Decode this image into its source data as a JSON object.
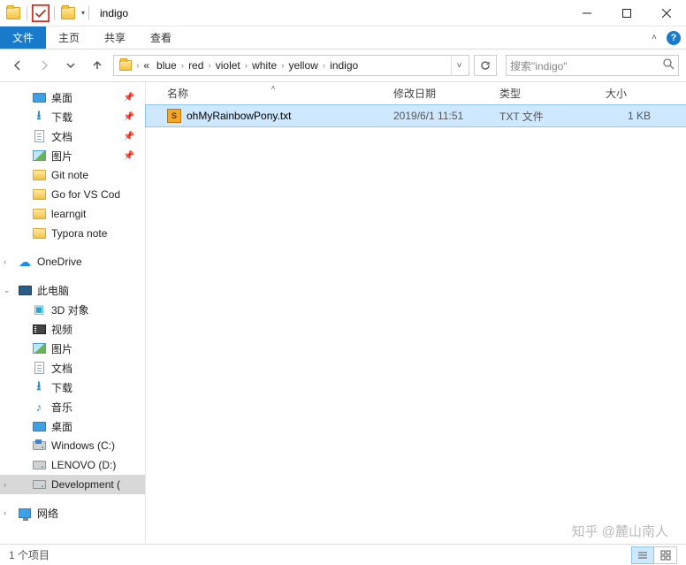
{
  "title": "indigo",
  "ribbon": {
    "file": "文件",
    "home": "主页",
    "share": "共享",
    "view": "查看"
  },
  "breadcrumbs": [
    "blue",
    "red",
    "violet",
    "white",
    "yellow",
    "indigo"
  ],
  "breadcrumb_overflow": "«",
  "search": {
    "placeholder": "搜索\"indigo\""
  },
  "columns": {
    "name": "名称",
    "date": "修改日期",
    "type": "类型",
    "size": "大小"
  },
  "files": [
    {
      "name": "ohMyRainbowPony.txt",
      "date": "2019/6/1 11:51",
      "type": "TXT 文件",
      "size": "1 KB"
    }
  ],
  "sidebar": {
    "quick": [
      {
        "label": "桌面",
        "icon": "desktop",
        "pinned": true
      },
      {
        "label": "下载",
        "icon": "download",
        "pinned": true
      },
      {
        "label": "文档",
        "icon": "doc",
        "pinned": true
      },
      {
        "label": "图片",
        "icon": "pic",
        "pinned": true
      },
      {
        "label": "Git note",
        "icon": "folder"
      },
      {
        "label": "Go for VS Cod",
        "icon": "folder"
      },
      {
        "label": "learngit",
        "icon": "folder"
      },
      {
        "label": "Typora note",
        "icon": "folder"
      }
    ],
    "onedrive": "OneDrive",
    "thispc": "此电脑",
    "pc_items": [
      {
        "label": "3D 对象",
        "icon": "3d"
      },
      {
        "label": "视频",
        "icon": "video"
      },
      {
        "label": "图片",
        "icon": "pic"
      },
      {
        "label": "文档",
        "icon": "doc"
      },
      {
        "label": "下载",
        "icon": "download"
      },
      {
        "label": "音乐",
        "icon": "music"
      },
      {
        "label": "桌面",
        "icon": "desktop"
      },
      {
        "label": "Windows (C:)",
        "icon": "drive-win"
      },
      {
        "label": "LENOVO (D:)",
        "icon": "drive"
      },
      {
        "label": "Development (",
        "icon": "drive",
        "selected": true
      }
    ],
    "network": "网络"
  },
  "status": {
    "count": "1 个项目"
  },
  "watermark": "知乎 @麓山南人"
}
